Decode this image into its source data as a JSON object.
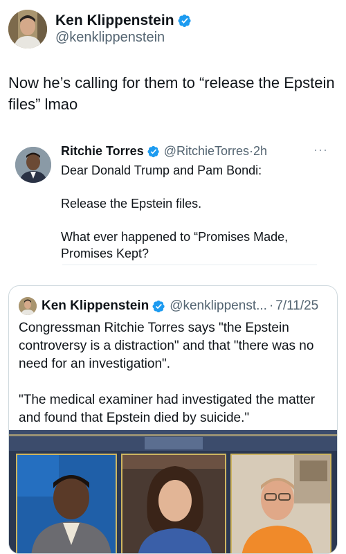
{
  "author": {
    "name": "Ken Klippenstein",
    "handle": "@kenklippenstein",
    "verified": true,
    "verified_icon": "verified-badge-icon"
  },
  "tweet": {
    "text": "Now he’s calling for them to “release the Epstein files” lmao"
  },
  "embedded_post": {
    "name": "Ritchie Torres",
    "verified": true,
    "handle": "@RitchieTorres",
    "separator": "·",
    "time": "2h",
    "more_icon": "···",
    "paragraphs": [
      "Dear Donald Trump and Pam Bondi:",
      "Release the Epstein files.",
      "What ever happened to “Promises Made, Promises Kept?"
    ]
  },
  "quoted_post": {
    "name": "Ken Klippenstein",
    "verified": true,
    "handle": "@kenklippenst...",
    "separator": "·",
    "date": "7/11/25",
    "paragraphs": [
      "Congressman Ritchie Torres says \"the Epstein controversy is a distraction\" and that \"there was no need for an investigation\".",
      "\"The medical examiner had investigated the matter and found that Epstein died by suicide.\""
    ]
  },
  "colors": {
    "verified_blue": "#1d9bf0",
    "secondary_text": "#536471",
    "border": "#cfd9de"
  }
}
